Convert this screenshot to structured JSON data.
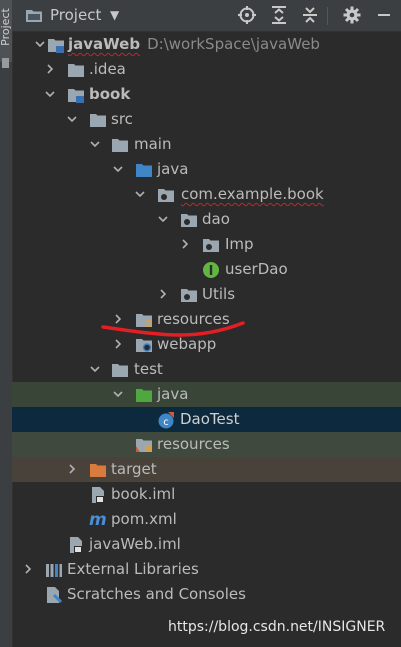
{
  "sidebar": {
    "label": "Project"
  },
  "header": {
    "title": "Project",
    "dropdown_icon": "caret-down-icon"
  },
  "tree": [
    {
      "name": "javaWeb",
      "path": "D:\\workSpace\\javaWeb",
      "icon": "module-folder-icon",
      "bold": true,
      "underline": true
    },
    {
      "name": ".idea",
      "icon": "folder-icon"
    },
    {
      "name": "book",
      "icon": "module-folder-icon",
      "bold": true
    },
    {
      "name": "src",
      "icon": "folder-icon"
    },
    {
      "name": "main",
      "icon": "folder-icon"
    },
    {
      "name": "java",
      "icon": "source-folder-icon"
    },
    {
      "name": "com.example.book",
      "icon": "package-icon",
      "underline": true
    },
    {
      "name": "dao",
      "icon": "package-icon"
    },
    {
      "name": "Imp",
      "icon": "package-icon"
    },
    {
      "name": "userDao",
      "icon": "interface-icon"
    },
    {
      "name": "Utils",
      "icon": "package-icon"
    },
    {
      "name": "resources",
      "icon": "resources-folder-icon"
    },
    {
      "name": "webapp",
      "icon": "web-folder-icon"
    },
    {
      "name": "test",
      "icon": "folder-icon"
    },
    {
      "name": "java",
      "icon": "test-source-folder-icon"
    },
    {
      "name": "DaoTest",
      "icon": "test-class-icon"
    },
    {
      "name": "resources",
      "icon": "test-resources-folder-icon"
    },
    {
      "name": "target",
      "icon": "excluded-folder-icon"
    },
    {
      "name": "book.iml",
      "icon": "iml-file-icon"
    },
    {
      "name": "pom.xml",
      "icon": "maven-icon"
    },
    {
      "name": "javaWeb.iml",
      "icon": "iml-file-icon"
    },
    {
      "name": "External Libraries",
      "icon": "libraries-icon"
    },
    {
      "name": "Scratches and Consoles",
      "icon": "scratches-icon"
    }
  ],
  "watermark": "https://blog.csdn.net/INSIGNER",
  "colors": {
    "background": "#2b2b2b",
    "selection": "#0d293e",
    "annotation": "#e31e24"
  }
}
